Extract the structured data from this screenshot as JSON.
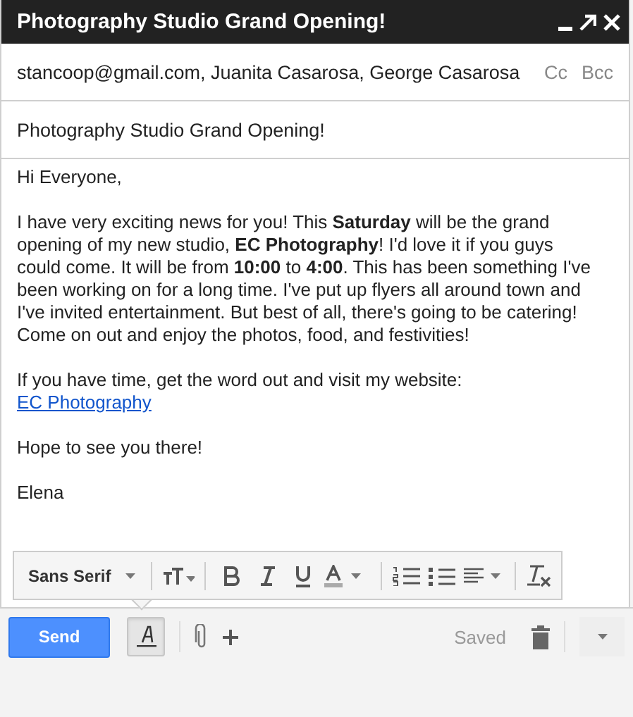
{
  "window": {
    "title": "Photography Studio Grand Opening!"
  },
  "to": {
    "value": "stancoop@gmail.com, Juanita Casarosa, George Casarosa",
    "cc": "Cc",
    "bcc": "Bcc"
  },
  "subject": {
    "value": "Photography Studio Grand Opening!"
  },
  "body": {
    "paragraphs": [
      {
        "text": "Hi Everyone,"
      },
      {
        "text": "I have very exciting news for you! This **Saturday** will be the grand opening of my new studio, **EC Photography**! I'd love it if you guys could come. It will be from **10:00** to **4:00**. This has been something I've been working on for a long time. I've put up flyers all around town and I've invited entertainment. But best of all, there's going to be catering! Come on out and enjoy the photos, food, and festivities!"
      },
      {
        "text": "If you have time, get the word out and visit my website: ",
        "link": "EC Photography"
      },
      {
        "text": "Hope to see you there!"
      },
      {
        "text": "Elena"
      }
    ]
  },
  "format_toolbar": {
    "font": "Sans Serif"
  },
  "footer": {
    "send": "Send",
    "formatting": {
      "selected": true
    },
    "status": "Saved"
  }
}
